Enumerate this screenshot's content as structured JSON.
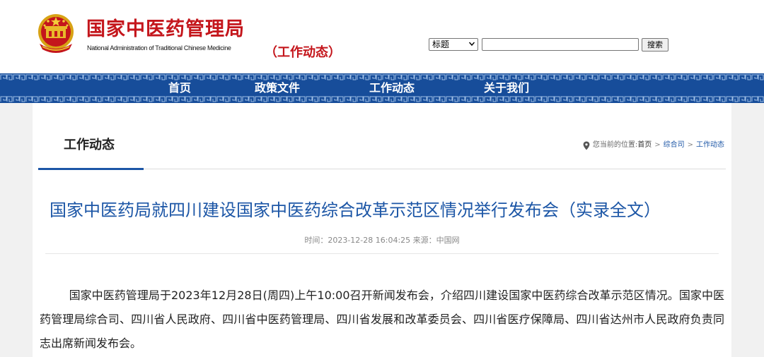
{
  "header": {
    "site_title": "国家中医药管理局",
    "site_subtitle": "National Administration of Traditional Chinese Medicine",
    "section_tag": "（工作动态）",
    "emblem_icon": "national-emblem-icon"
  },
  "search": {
    "field_selected": "标题",
    "query_value": "",
    "button_label": "搜索"
  },
  "nav": {
    "items": [
      {
        "label": "首页"
      },
      {
        "label": "政策文件"
      },
      {
        "label": "工作动态"
      },
      {
        "label": "关于我们"
      }
    ]
  },
  "page": {
    "heading": "工作动态",
    "breadcrumb": {
      "prefix": "您当前的位置:",
      "items": [
        "首页",
        "综合司",
        "工作动态"
      ],
      "separator": ">"
    }
  },
  "article": {
    "title": "国家中医药局就四川建设国家中医药综合改革示范区情况举行发布会（实录全文）",
    "meta": "时间：2023-12-28 16:04:25 来源：中国网",
    "body": "国家中医药管理局于2023年12月28日(周四)上午10:00召开新闻发布会，介绍四川建设国家中医药综合改革示范区情况。国家中医药管理局综合司、四川省人民政府、四川省中医药管理局、四川省发展和改革委员会、四川省医疗保障局、四川省达州市人民政府负责同志出席新闻发布会。"
  },
  "colors": {
    "brand_red": "#c4161c",
    "nav_blue": "#174d9a",
    "link_blue": "#1c56a6"
  }
}
